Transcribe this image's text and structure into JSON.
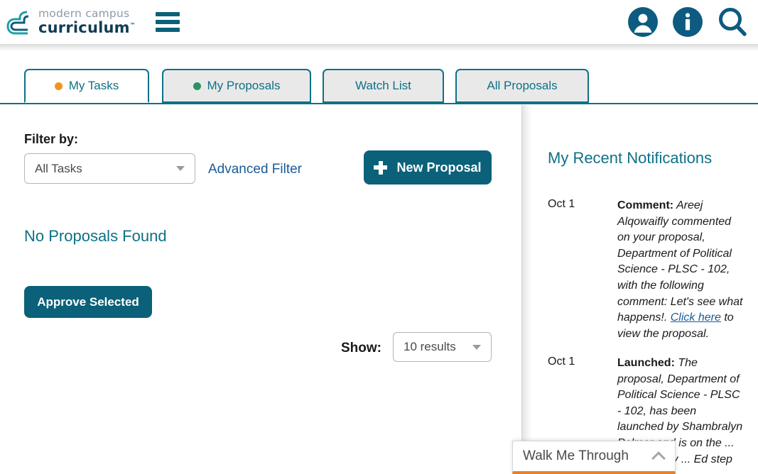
{
  "header": {
    "logo_line1": "modern campus",
    "logo_line2": "curriculum",
    "logo_tm": "™",
    "menu_icon": "hamburger-icon",
    "icons": [
      {
        "name": "user-account-icon",
        "label": "Account"
      },
      {
        "name": "info-icon",
        "label": "Information"
      },
      {
        "name": "search-icon",
        "label": "Search"
      }
    ]
  },
  "tabs": [
    {
      "label": "My Tasks",
      "dot": "#f0941e",
      "active": true
    },
    {
      "label": "My Proposals",
      "dot": "#2e9360",
      "active": false
    },
    {
      "label": "Watch List",
      "dot": null,
      "active": false
    },
    {
      "label": "All Proposals",
      "dot": null,
      "active": false
    }
  ],
  "main": {
    "filter_label": "Filter by:",
    "filter_select": {
      "value": "All Tasks",
      "options": [
        "All Tasks"
      ]
    },
    "advanced_filter_label": "Advanced Filter",
    "new_proposal_label": "New Proposal",
    "empty_state": "No Proposals Found",
    "approve_selected_label": "Approve Selected",
    "show_label": "Show:",
    "show_select": {
      "value": "10 results",
      "options": [
        "10 results"
      ]
    }
  },
  "notifications": {
    "title": "My Recent Notifications",
    "items": [
      {
        "date": "Oct 1",
        "type": "Comment:",
        "text_before_link": " Areej Alqowaifly commented on your proposal, Department of Political Science - PLSC - 102, with the following comment: Let's see what happens!. ",
        "link": "Click here",
        "text_after_link": " to view the proposal."
      },
      {
        "date": "Oct 1",
        "type": "Launched:",
        "text_before_link": " The proposal, Department of Political Science - PLSC - 102, has been launched by Shambralyn Palmer and is on the ... reviewed by ... Ed step",
        "link": null,
        "text_after_link": ""
      }
    ]
  },
  "walk_me_through": {
    "label": "Walk Me Through",
    "chevron": "chevron-up-icon"
  },
  "colors": {
    "teal": "#0d7186",
    "teal_dark": "#0a6179",
    "navy": "#123d54",
    "link_blue": "#1a5a96",
    "orange": "#e8802a",
    "tab_inactive_bg": "#e9e9e9"
  }
}
